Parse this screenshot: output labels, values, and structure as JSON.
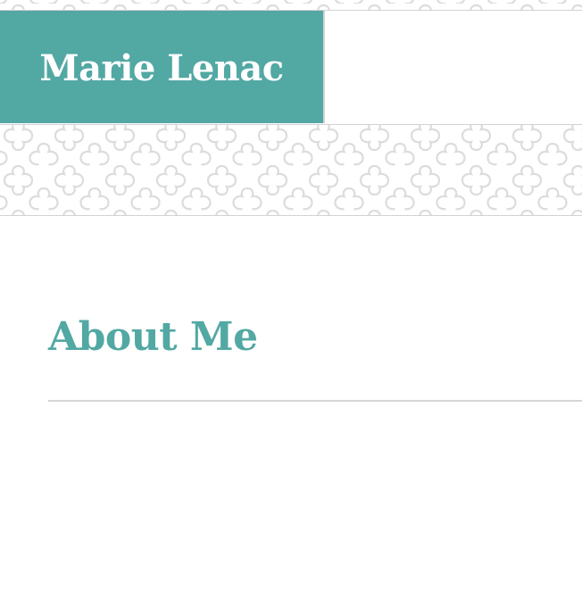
{
  "site": {
    "title": "Marie Lenac",
    "accent_color": "#52a8a3",
    "pattern": "quatrefoil-lattice",
    "pattern_color": "#dcdcdc"
  },
  "page": {
    "title": "About Me"
  }
}
